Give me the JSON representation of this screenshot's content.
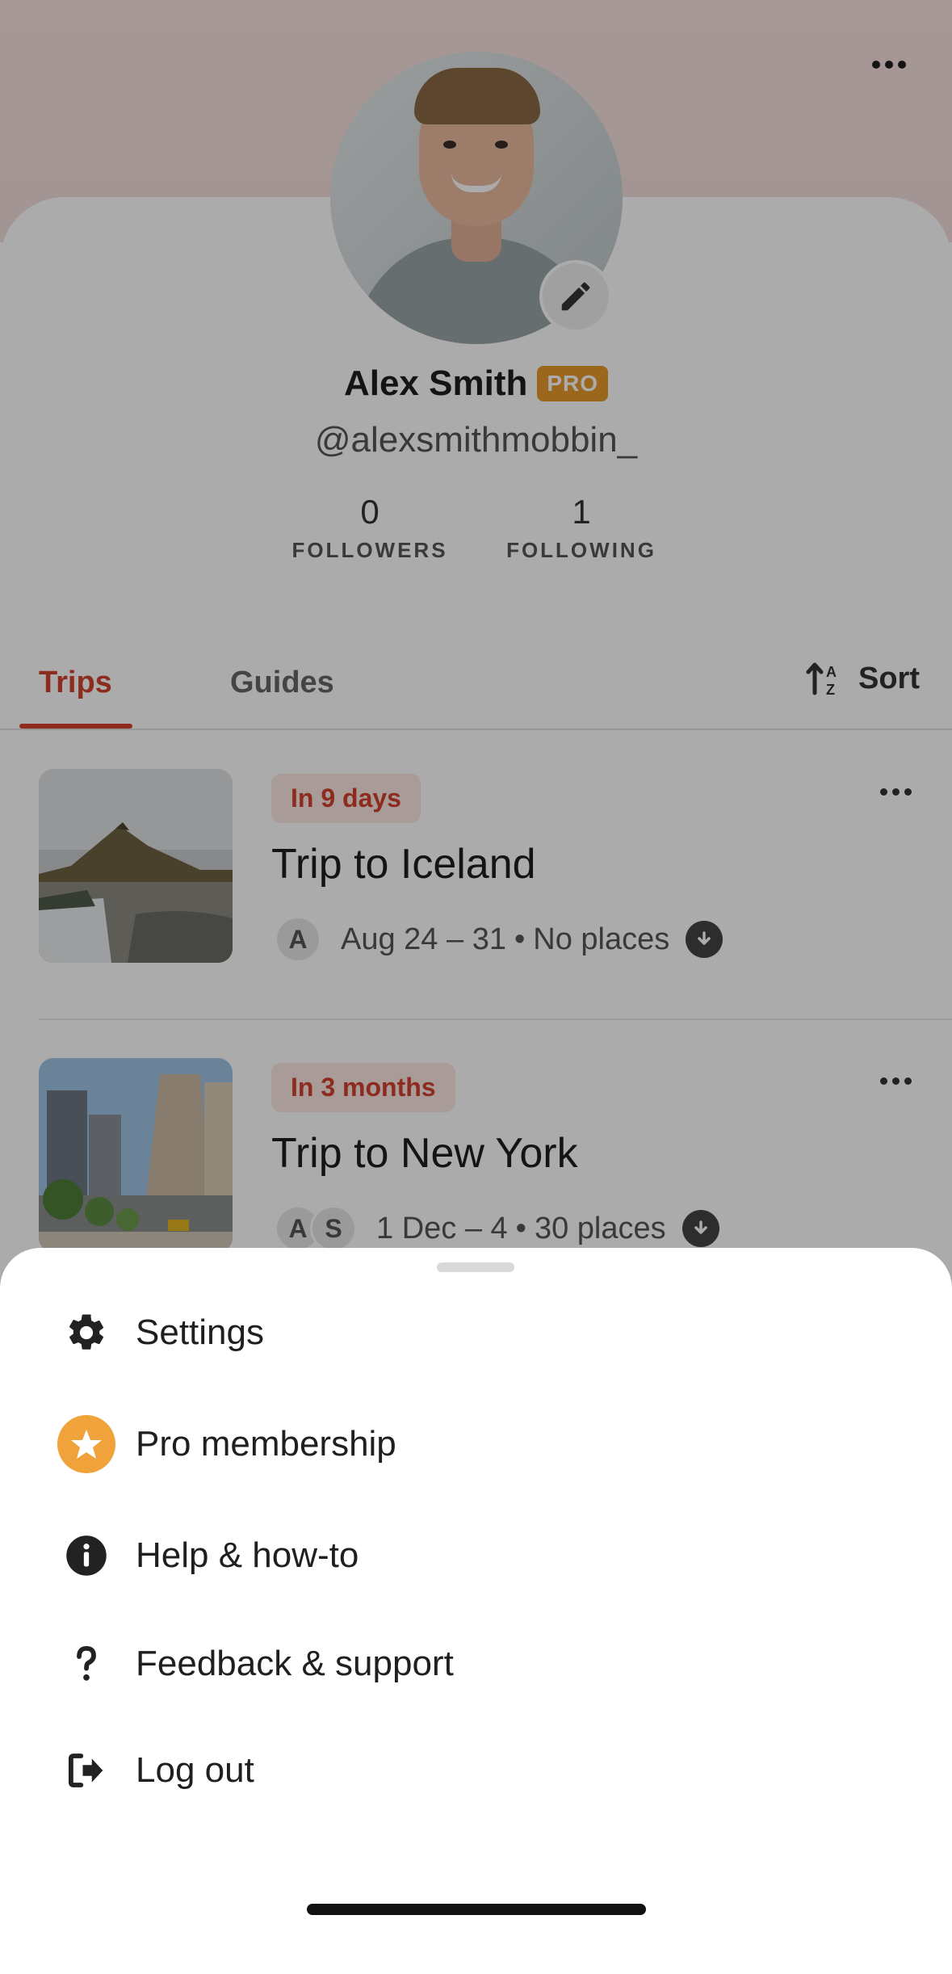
{
  "profile": {
    "name": "Alex Smith",
    "badge": "PRO",
    "handle": "@alexsmithmobbin_",
    "followers": {
      "count": "0",
      "label": "FOLLOWERS"
    },
    "following": {
      "count": "1",
      "label": "FOLLOWING"
    }
  },
  "tabs": {
    "items": [
      {
        "label": "Trips",
        "active": true
      },
      {
        "label": "Guides",
        "active": false
      }
    ],
    "sort_label": "Sort"
  },
  "trips": [
    {
      "tag": "In 9 days",
      "title": "Trip to Iceland",
      "avatars": [
        "A"
      ],
      "dates": "Aug 24 –  31",
      "sep": "•",
      "places": "No places"
    },
    {
      "tag": "In 3 months",
      "title": "Trip to New York",
      "avatars": [
        "A",
        "S"
      ],
      "dates": "1 Dec – 4",
      "sep": "•",
      "places": "30 places"
    }
  ],
  "menu": {
    "items": [
      {
        "label": "Settings",
        "icon": "gear-icon"
      },
      {
        "label": "Pro membership",
        "icon": "star-icon"
      },
      {
        "label": "Help & how-to",
        "icon": "info-icon"
      },
      {
        "label": "Feedback & support",
        "icon": "question-icon"
      },
      {
        "label": "Log out",
        "icon": "logout-icon"
      }
    ]
  },
  "colors": {
    "accent": "#d2412f",
    "pro": "#e89a2c",
    "tag_bg": "#fde7e3"
  }
}
